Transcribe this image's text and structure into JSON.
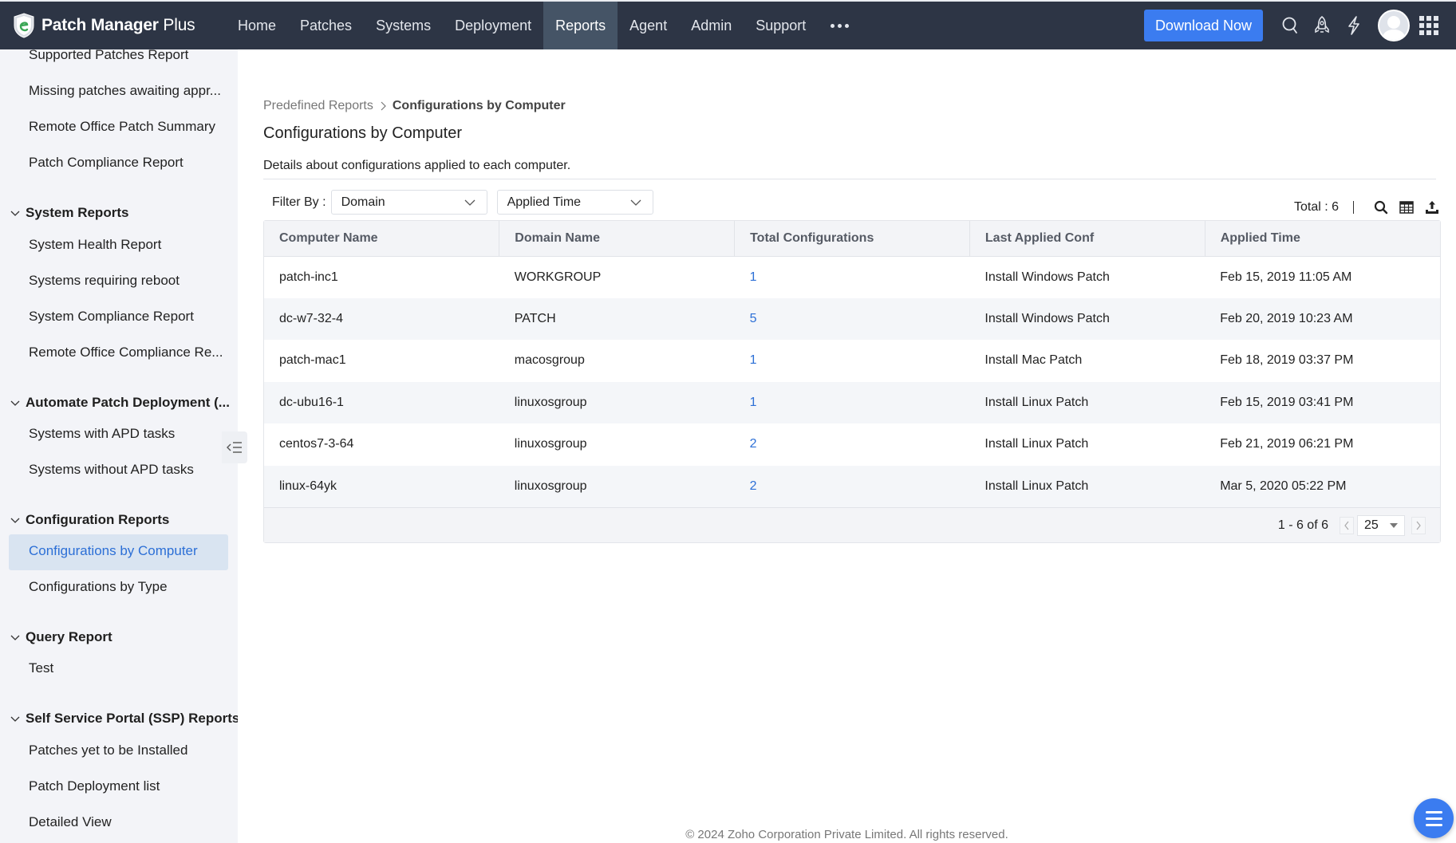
{
  "app": {
    "name_bold": "Patch Manager",
    "name_light": " Plus"
  },
  "nav": {
    "items": [
      {
        "label": "Home",
        "active": false
      },
      {
        "label": "Patches",
        "active": false
      },
      {
        "label": "Systems",
        "active": false
      },
      {
        "label": "Deployment",
        "active": false
      },
      {
        "label": "Reports",
        "active": true
      },
      {
        "label": "Agent",
        "active": false
      },
      {
        "label": "Admin",
        "active": false
      },
      {
        "label": "Support",
        "active": false
      }
    ],
    "more_icon": "more-horizontal-icon",
    "download_label": "Download Now",
    "icons": [
      "search-icon",
      "rocket-icon",
      "lightning-icon",
      "avatar",
      "apps-grid-icon"
    ]
  },
  "sidebar": {
    "patch_items": [
      "Supported Patches Report",
      "Missing patches awaiting appr...",
      "Remote Office Patch Summary",
      "Patch Compliance Report"
    ],
    "sections": [
      {
        "title": "System Reports",
        "items": [
          "System Health Report",
          "Systems requiring reboot",
          "System Compliance Report",
          "Remote Office Compliance Re..."
        ]
      },
      {
        "title": "Automate Patch Deployment (...",
        "items": [
          "Systems with APD tasks",
          "Systems without APD tasks"
        ]
      },
      {
        "title": "Configuration Reports",
        "items": [
          "Configurations by Computer",
          "Configurations by Type"
        ],
        "selected": "Configurations by Computer"
      },
      {
        "title": "Query Report",
        "items": [
          "Test"
        ]
      },
      {
        "title": "Self Service Portal (SSP) Reports",
        "items": [
          "Patches yet to be Installed",
          "Patch Deployment list",
          "Detailed View"
        ]
      }
    ]
  },
  "breadcrumb": {
    "parent": "Predefined Reports",
    "current": "Configurations by Computer"
  },
  "page": {
    "title": "Configurations by Computer",
    "description": "Details about configurations applied to each computer."
  },
  "filters": {
    "label": "Filter By :",
    "domain": "Domain",
    "time": "Applied Time"
  },
  "toolbar": {
    "total": "Total : 6",
    "icons": [
      "search-icon",
      "column-chooser-icon",
      "export-icon"
    ]
  },
  "table": {
    "columns": [
      "Computer Name",
      "Domain Name",
      "Total Configurations",
      "Last Applied Conf",
      "Applied Time"
    ],
    "rows": [
      {
        "computer": "patch-inc1",
        "domain": "WORKGROUP",
        "total": "1",
        "last_conf": "Install Windows Patch",
        "time": "Feb 15, 2019 11:05 AM"
      },
      {
        "computer": "dc-w7-32-4",
        "domain": "PATCH",
        "total": "5",
        "last_conf": "Install Windows Patch",
        "time": "Feb 20, 2019 10:23 AM"
      },
      {
        "computer": "patch-mac1",
        "domain": "macosgroup",
        "total": "1",
        "last_conf": "Install Mac Patch",
        "time": "Feb 18, 2019 03:37 PM"
      },
      {
        "computer": "dc-ubu16-1",
        "domain": "linuxosgroup",
        "total": "1",
        "last_conf": "Install Linux Patch",
        "time": "Feb 15, 2019 03:41 PM"
      },
      {
        "computer": "centos7-3-64",
        "domain": "linuxosgroup",
        "total": "2",
        "last_conf": "Install Linux Patch",
        "time": "Feb 21, 2019 06:21 PM"
      },
      {
        "computer": "linux-64yk",
        "domain": "linuxosgroup",
        "total": "2",
        "last_conf": "Install Linux Patch",
        "time": "Mar 5, 2020 05:22 PM"
      }
    ]
  },
  "pagination": {
    "range": "1 - 6 of 6",
    "page_size": "25"
  },
  "footer": {
    "copyright": "© 2024 Zoho Corporation Private Limited. All rights reserved."
  },
  "colors": {
    "topbar": "#2d3545",
    "active_nav": "#455466",
    "accent": "#3b7cf0",
    "link": "#2c6fd6",
    "sidebar_bg": "#f3f4f8",
    "sidebar_selected_bg": "#d9e4f1"
  }
}
